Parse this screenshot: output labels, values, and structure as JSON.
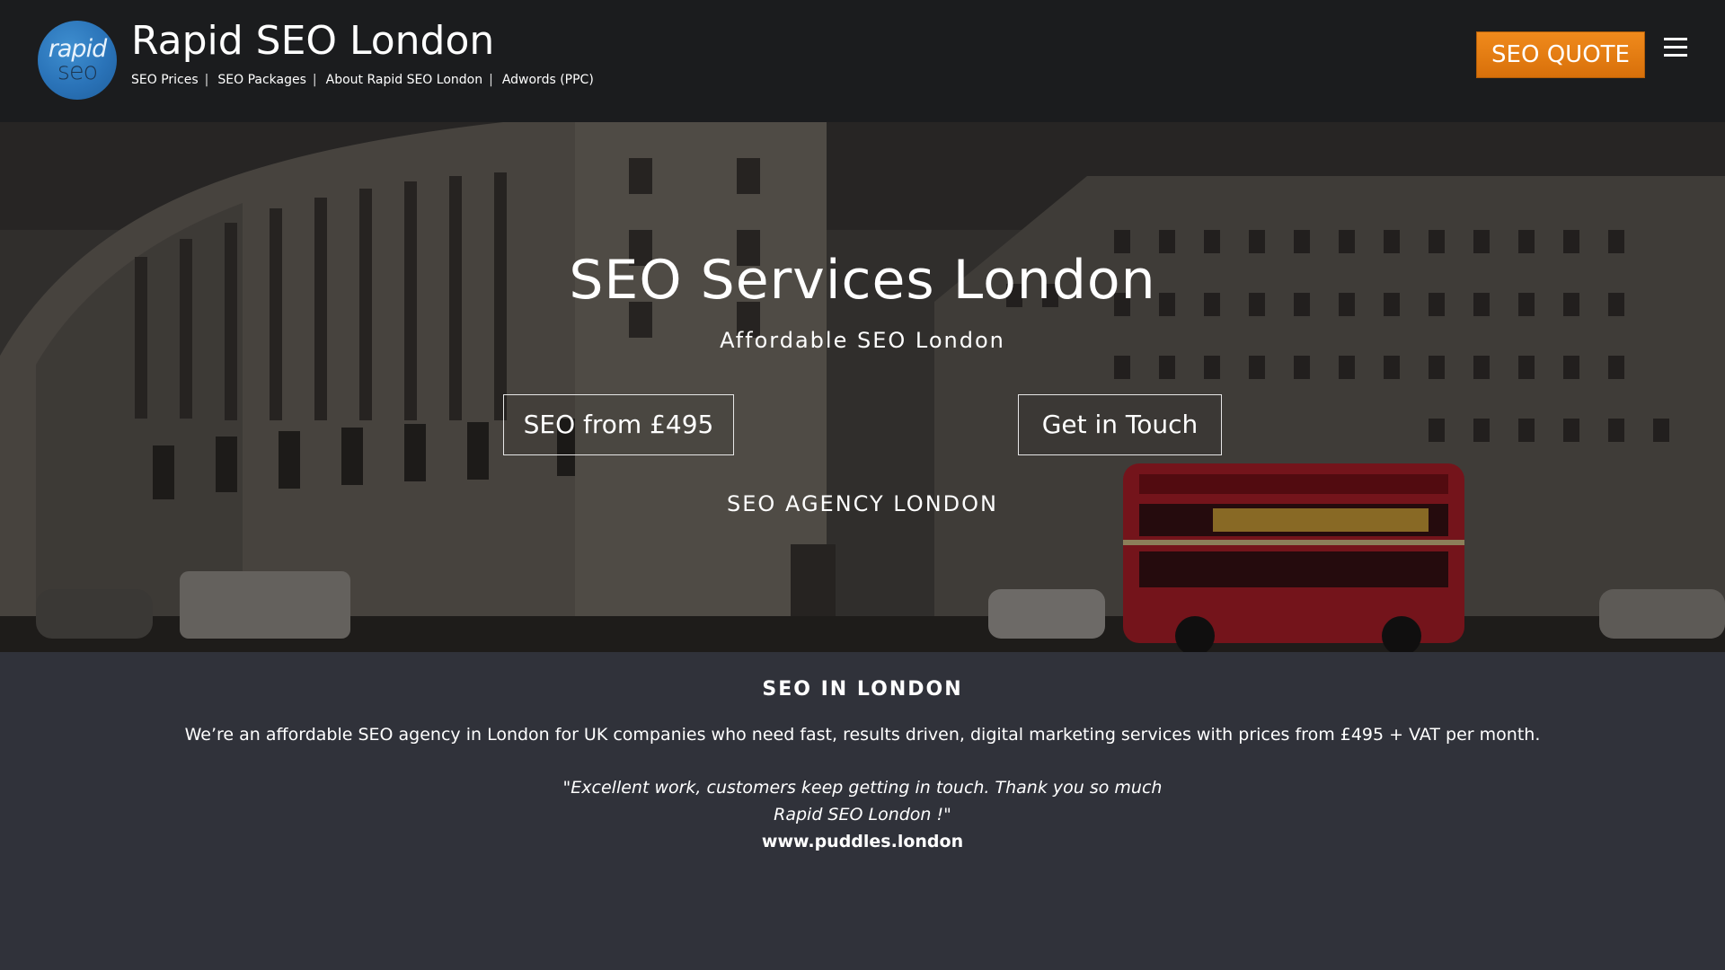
{
  "header": {
    "logo": {
      "line1": "rapid",
      "line2": "seo",
      "icon": "rapid-seo-logo"
    },
    "site_title": "Rapid SEO London",
    "nav": [
      {
        "label": "SEO Prices"
      },
      {
        "label": "SEO Packages"
      },
      {
        "label": "About Rapid SEO London"
      },
      {
        "label": "Adwords (PPC)"
      }
    ],
    "nav_separator": "|",
    "quote_button": "SEO QUOTE",
    "menu_icon": "hamburger-menu-icon"
  },
  "hero": {
    "title": "SEO Services London",
    "subtitle": "Affordable SEO London",
    "primary_button": "SEO from £495",
    "secondary_button": "Get in Touch",
    "tagline": "SEO AGENCY LONDON"
  },
  "content": {
    "heading": "SEO IN LONDON",
    "intro": "We’re an affordable SEO agency in London for UK companies who need fast, results driven, digital marketing services with prices from £495 + VAT per month.",
    "testimonial": {
      "quote": "\"Excellent work, customers keep getting in touch. Thank you so much Rapid SEO London !\"",
      "source": "www.puddles.london"
    }
  },
  "colors": {
    "header_bg": "#1b1c1e",
    "content_bg": "#30323a",
    "quote_button": "#e67c12",
    "logo_blue": "#2a73b8",
    "bus_red": "#b3202a"
  }
}
